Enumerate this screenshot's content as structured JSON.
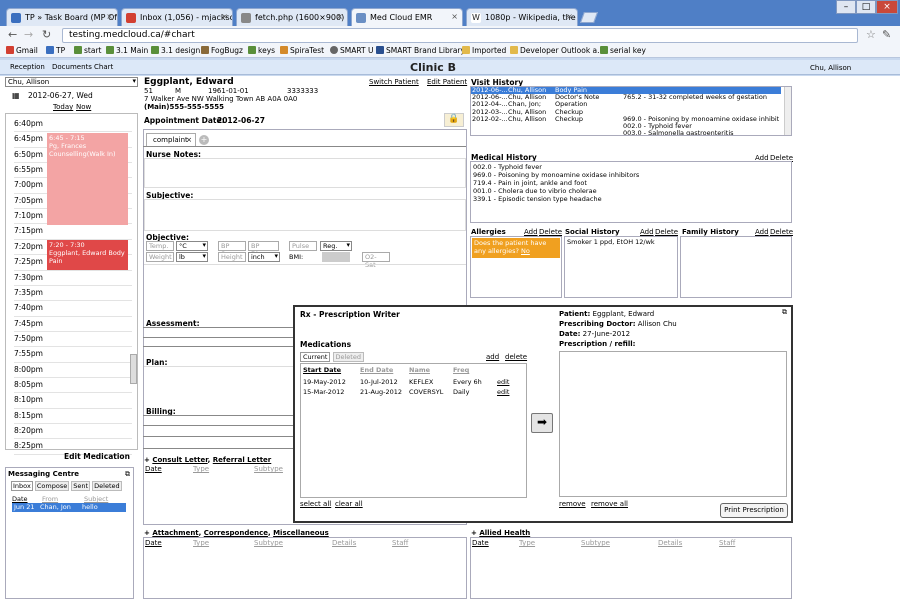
{
  "browser": {
    "tabs": [
      {
        "title": "TP » Task Board (MP Office",
        "color": "#3b6fbf"
      },
      {
        "title": "Inbox (1,056) - mjacksonch",
        "color": "#d23f31"
      },
      {
        "title": "fetch.php (1600×900)",
        "color": "#888888"
      },
      {
        "title": "Med Cloud EMR",
        "color": "#6a8fc4"
      },
      {
        "title": "1080p - Wikipedia, the free",
        "color": "#444444"
      }
    ],
    "url": "testing.medcloud.ca/#chart",
    "bookmarks": [
      "Gmail",
      "TP",
      "start",
      "3.1 Main",
      "3.1 design",
      "FogBugz",
      "keys",
      "SpiraTest",
      "SMART U",
      "SMART Brand Library",
      "Imported",
      "Developer Outlook a...",
      "serial key"
    ]
  },
  "app": {
    "tabs": [
      "Reception",
      "Documents",
      "Chart"
    ],
    "clinic": "Clinic B",
    "user": "Chu, Allison"
  },
  "calendar": {
    "provider": "Chu, Allison",
    "date": "2012-06-27, Wed",
    "today": "Today",
    "now": "Now",
    "times": [
      "6:40pm",
      "6:45pm",
      "6:50pm",
      "6:55pm",
      "7:00pm",
      "7:05pm",
      "7:10pm",
      "7:15pm",
      "7:20pm",
      "7:25pm",
      "7:30pm",
      "7:35pm",
      "7:40pm",
      "7:45pm",
      "7:50pm",
      "7:55pm",
      "8:00pm",
      "8:05pm",
      "8:10pm",
      "8:15pm",
      "8:20pm",
      "8:25pm"
    ],
    "event1": {
      "time": "6:45 - 7:15",
      "text": "Pg, Frances Counselling(Walk In)"
    },
    "event2": {
      "time": "7:20 - 7:30",
      "text": "Eggplant, Edward Body Pain"
    },
    "edit_medication": "Edit Medication"
  },
  "messaging": {
    "title": "Messaging Centre",
    "tabs": [
      "Inbox",
      "Compose",
      "Sent",
      "Deleted"
    ],
    "cols": [
      "Date",
      "From",
      "Subject"
    ],
    "row": {
      "date": "Jun 21",
      "from": "Chan, Jon",
      "subject": "hello"
    }
  },
  "patient": {
    "name": "Eggplant, Edward",
    "num": "51",
    "sex": "M",
    "dob": "1961-01-01",
    "hc": "3333333",
    "address": "7 Walker Ave NW Walking Town AB A0A 0A0",
    "phone": "(Main)555-555-5555",
    "switch": "Switch Patient",
    "edit": "Edit Patient",
    "appt_label": "Appointment Date:",
    "appt_date": "2012-06-27"
  },
  "chart": {
    "tab": "complaint",
    "sections": [
      "Nurse Notes:",
      "Subjective:",
      "Objective:",
      "Assessment:",
      "Plan:",
      "Billing:"
    ],
    "vitals": {
      "temp": "Temp.",
      "c": "°C",
      "bpsys": "BP Sys.",
      "bpdias": "BP Dias.",
      "pulse": "Pulse",
      "reg": "Reg.",
      "weight": "Weight",
      "lb": "lb",
      "height": "Height",
      "inch": "inch",
      "bmi": "BMI:",
      "o2": "O2-Sat"
    },
    "consult": {
      "prefix": "+",
      "consult": "Consult Letter",
      "referral": "Referral Letter",
      "cols": [
        "Date",
        "Type",
        "Subtype"
      ]
    },
    "attach": {
      "prefix": "+",
      "attachment": "Attachment",
      "correspondence": "Correspondence",
      "misc": "Miscellaneous",
      "cols": [
        "Date",
        "Type",
        "Subtype",
        "Details",
        "Staff"
      ]
    }
  },
  "visit_history": {
    "title": "Visit History",
    "rows": [
      {
        "date": "2012-06-...",
        "doc": "Chu, Allison",
        "type": "Body Pain",
        "note": ""
      },
      {
        "date": "2012-06-...",
        "doc": "Chu, Allison",
        "type": "Doctor's Note",
        "note": "765.2 - 31-32 completed weeks of gestation"
      },
      {
        "date": "2012-04-...",
        "doc": "Chan, Jon;",
        "type": "Operation",
        "note": ""
      },
      {
        "date": "2012-03-...",
        "doc": "Chu, Allison",
        "type": "Checkup",
        "note": ""
      },
      {
        "date": "2012-02-...",
        "doc": "Chu, Allison",
        "type": "Checkup",
        "note": "969.0 - Poisoning by monoamine oxidase inhibit"
      },
      {
        "date": "",
        "doc": "",
        "type": "",
        "note": "002.0 - Typhoid fever"
      },
      {
        "date": "",
        "doc": "",
        "type": "",
        "note": "003.0 - Salmonella gastroenteritis"
      }
    ]
  },
  "medical_history": {
    "title": "Medical History",
    "add": "Add",
    "del": "Delete",
    "items": [
      "002.0 - Typhoid fever",
      "969.0 - Poisoning by monoamine oxidase inhibitors",
      "719.4 - Pain in joint, ankle and foot",
      "001.0 - Cholera due to vibrio cholerae",
      "339.1 - Episodic tension type headache"
    ]
  },
  "allergies": {
    "title": "Allergies",
    "add": "Add",
    "del": "Delete",
    "prompt": "Does the patient have any allergies?",
    "no": "No"
  },
  "social": {
    "title": "Social History",
    "add": "Add",
    "del": "Delete",
    "text": "Smoker 1 ppd, EtOH 12/wk"
  },
  "family": {
    "title": "Family History",
    "add": "Add",
    "del": "Delete"
  },
  "allied": {
    "prefix": "+",
    "title": "Allied Health",
    "cols": [
      "Date",
      "Type",
      "Subtype",
      "Details",
      "Staff"
    ]
  },
  "rx": {
    "title": "Rx - Prescription Writer",
    "medications": "Medications",
    "tabs": [
      "Current",
      "Deleted"
    ],
    "add": "add",
    "del": "delete",
    "cols": [
      "Start Date",
      "End Date",
      "Name",
      "Freq"
    ],
    "rows": [
      {
        "start": "19-May-2012",
        "end": "10-Jul-2012",
        "name": "KEFLEX",
        "freq": "Every 6h",
        "edit": "edit"
      },
      {
        "start": "15-Mar-2012",
        "end": "21-Aug-2012",
        "name": "COVERSYL",
        "freq": "Daily",
        "edit": "edit"
      }
    ],
    "select_all": "select all",
    "clear_all": "clear all",
    "patient_label": "Patient:",
    "patient": "Eggplant, Edward",
    "doctor_label": "Prescribing Doctor:",
    "doctor": "Allison Chu",
    "date_label": "Date:",
    "date": "27-June-2012",
    "refill_label": "Prescription / refill:",
    "remove": "remove",
    "remove_all": "remove all",
    "print": "Print Prescription"
  }
}
